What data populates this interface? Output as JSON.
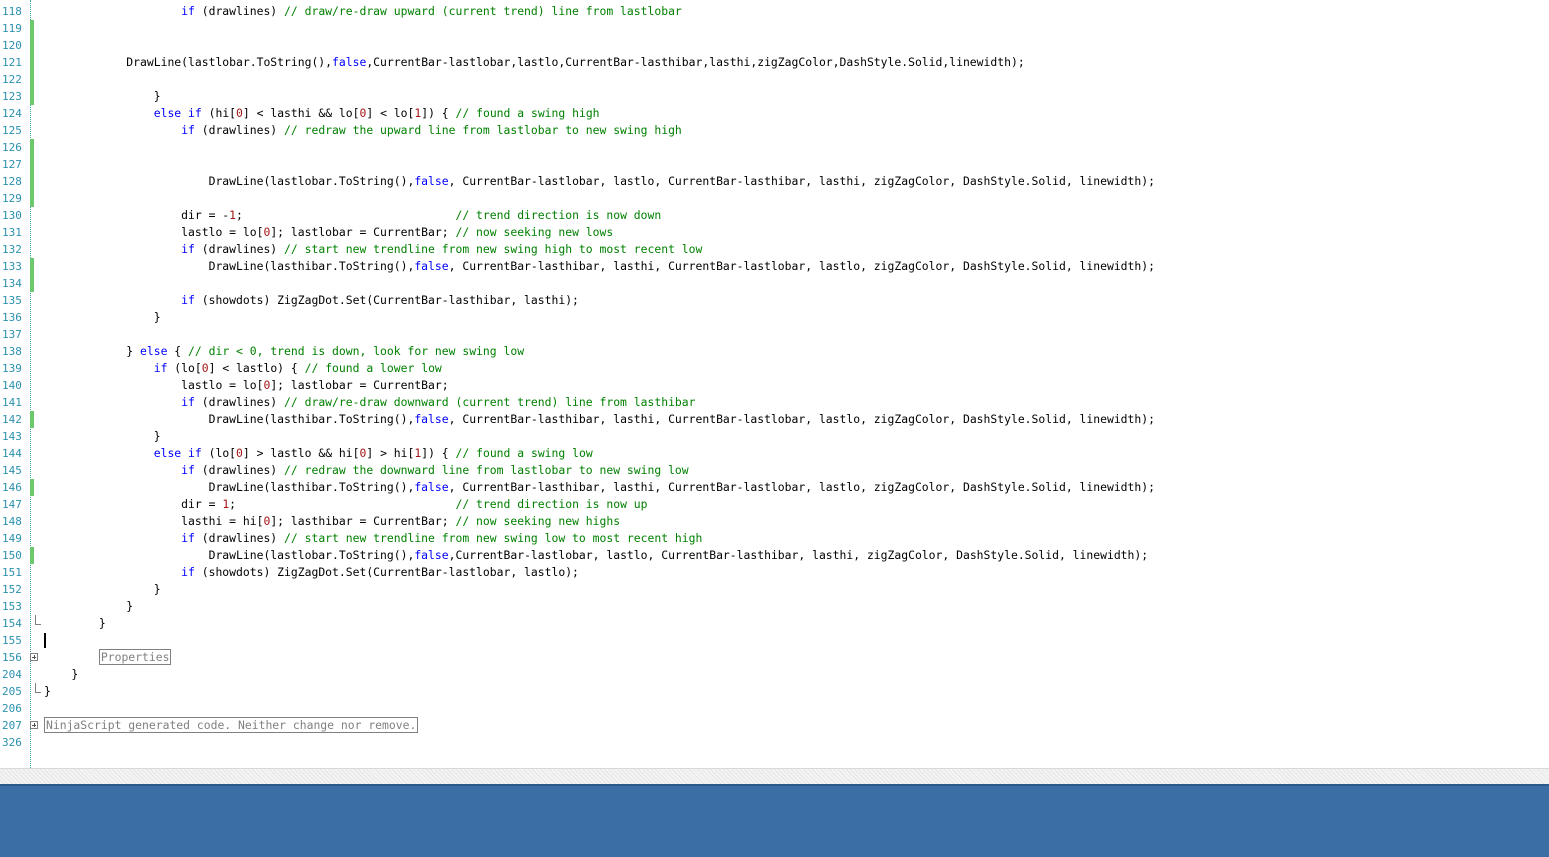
{
  "editor": {
    "lines": [
      {
        "n": "118",
        "changed": false,
        "text": "                    if (drawlines) // draw/re-draw upward (current trend) line from lastlobar"
      },
      {
        "n": "119",
        "changed": true,
        "text": ""
      },
      {
        "n": "120",
        "changed": true,
        "text": ""
      },
      {
        "n": "121",
        "changed": true,
        "text": "            DrawLine(lastlobar.ToString(),false,CurrentBar-lastlobar,lastlo,CurrentBar-lasthibar,lasthi,zigZagColor,DashStyle.Solid,linewidth);"
      },
      {
        "n": "122",
        "changed": true,
        "text": ""
      },
      {
        "n": "123",
        "changed": true,
        "text": "                }"
      },
      {
        "n": "124",
        "changed": false,
        "text": "                else if (hi[0] < lasthi && lo[0] < lo[1]) { // found a swing high"
      },
      {
        "n": "125",
        "changed": false,
        "text": "                    if (drawlines) // redraw the upward line from lastlobar to new swing high"
      },
      {
        "n": "126",
        "changed": true,
        "text": ""
      },
      {
        "n": "127",
        "changed": true,
        "text": ""
      },
      {
        "n": "128",
        "changed": true,
        "text": "                        DrawLine(lastlobar.ToString(),false, CurrentBar-lastlobar, lastlo, CurrentBar-lasthibar, lasthi, zigZagColor, DashStyle.Solid, linewidth);"
      },
      {
        "n": "129",
        "changed": true,
        "text": ""
      },
      {
        "n": "130",
        "changed": false,
        "text": "                    dir = -1;                               // trend direction is now down"
      },
      {
        "n": "131",
        "changed": false,
        "text": "                    lastlo = lo[0]; lastlobar = CurrentBar; // now seeking new lows"
      },
      {
        "n": "132",
        "changed": false,
        "text": "                    if (drawlines) // start new trendline from new swing high to most recent low"
      },
      {
        "n": "133",
        "changed": true,
        "text": "                        DrawLine(lasthibar.ToString(),false, CurrentBar-lasthibar, lasthi, CurrentBar-lastlobar, lastlo, zigZagColor, DashStyle.Solid, linewidth);"
      },
      {
        "n": "134",
        "changed": true,
        "text": ""
      },
      {
        "n": "135",
        "changed": false,
        "text": "                    if (showdots) ZigZagDot.Set(CurrentBar-lasthibar, lasthi);"
      },
      {
        "n": "136",
        "changed": false,
        "text": "                }"
      },
      {
        "n": "137",
        "changed": false,
        "text": ""
      },
      {
        "n": "138",
        "changed": false,
        "text": "            } else { // dir < 0, trend is down, look for new swing low"
      },
      {
        "n": "139",
        "changed": false,
        "text": "                if (lo[0] < lastlo) { // found a lower low"
      },
      {
        "n": "140",
        "changed": false,
        "text": "                    lastlo = lo[0]; lastlobar = CurrentBar;"
      },
      {
        "n": "141",
        "changed": false,
        "text": "                    if (drawlines) // draw/re-draw downward (current trend) line from lasthibar"
      },
      {
        "n": "142",
        "changed": true,
        "text": "                        DrawLine(lasthibar.ToString(),false, CurrentBar-lasthibar, lasthi, CurrentBar-lastlobar, lastlo, zigZagColor, DashStyle.Solid, linewidth);"
      },
      {
        "n": "143",
        "changed": false,
        "text": "                }"
      },
      {
        "n": "144",
        "changed": false,
        "text": "                else if (lo[0] > lastlo && hi[0] > hi[1]) { // found a swing low"
      },
      {
        "n": "145",
        "changed": false,
        "text": "                    if (drawlines) // redraw the downward line from lastlobar to new swing low"
      },
      {
        "n": "146",
        "changed": true,
        "text": "                        DrawLine(lasthibar.ToString(),false, CurrentBar-lasthibar, lasthi, CurrentBar-lastlobar, lastlo, zigZagColor, DashStyle.Solid, linewidth);"
      },
      {
        "n": "147",
        "changed": false,
        "text": "                    dir = 1;                                // trend direction is now up"
      },
      {
        "n": "148",
        "changed": false,
        "text": "                    lasthi = hi[0]; lasthibar = CurrentBar; // now seeking new highs"
      },
      {
        "n": "149",
        "changed": false,
        "text": "                    if (drawlines) // start new trendline from new swing low to most recent high"
      },
      {
        "n": "150",
        "changed": true,
        "text": "                        DrawLine(lastlobar.ToString(),false,CurrentBar-lastlobar, lastlo, CurrentBar-lasthibar, lasthi, zigZagColor, DashStyle.Solid, linewidth);"
      },
      {
        "n": "151",
        "changed": false,
        "text": "                    if (showdots) ZigZagDot.Set(CurrentBar-lastlobar, lastlo);"
      },
      {
        "n": "152",
        "changed": false,
        "text": "                }"
      },
      {
        "n": "153",
        "changed": false,
        "text": "            }"
      },
      {
        "n": "154",
        "changed": false,
        "foldEnd": true,
        "text": "        }"
      },
      {
        "n": "155",
        "changed": false,
        "caret": true,
        "text": ""
      },
      {
        "n": "156",
        "changed": false,
        "fold": true,
        "prefix": "        ",
        "collapsed": "Properties",
        "text": ""
      },
      {
        "n": "204",
        "changed": false,
        "text": "    }"
      },
      {
        "n": "205",
        "changed": false,
        "foldEnd": true,
        "text": "}"
      },
      {
        "n": "206",
        "changed": false,
        "text": ""
      },
      {
        "n": "207",
        "changed": false,
        "fold": true,
        "prefix": "",
        "collapsed": "NinjaScript generated code. Neither change nor remove.",
        "text": ""
      },
      {
        "n": "326",
        "changed": false,
        "text": ""
      }
    ]
  },
  "colors": {
    "keyword": "#0000ff",
    "comment": "#008000",
    "number": "#a31515",
    "linenumber": "#2b91af",
    "changed": "#6cc86c",
    "desktop": "#3a6ea5"
  }
}
